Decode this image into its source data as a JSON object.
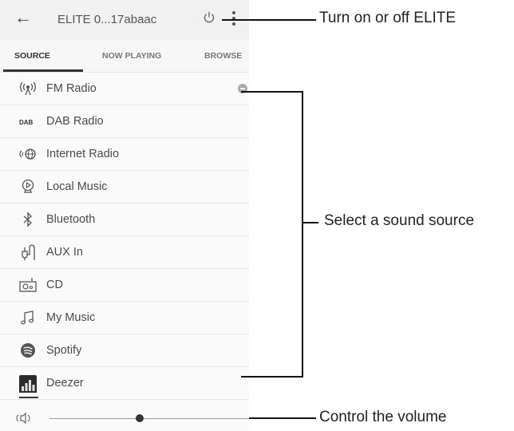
{
  "header": {
    "back_icon": "arrow-left-icon",
    "title": "ELITE 0...17abaac",
    "power_icon": "power-icon",
    "menu_icon": "more-vertical-icon"
  },
  "tabs": [
    {
      "label": "SOURCE",
      "active": true
    },
    {
      "label": "NOW PLAYING",
      "active": false
    },
    {
      "label": "BROWSE",
      "active": false
    }
  ],
  "sources": [
    {
      "label": "FM Radio",
      "icon": "fm-radio-icon",
      "selected": true
    },
    {
      "label": "DAB Radio",
      "icon": "dab-icon",
      "selected": false
    },
    {
      "label": "Internet Radio",
      "icon": "internet-radio-icon",
      "selected": false
    },
    {
      "label": "Local Music",
      "icon": "local-music-icon",
      "selected": false
    },
    {
      "label": "Bluetooth",
      "icon": "bluetooth-icon",
      "selected": false
    },
    {
      "label": "AUX In",
      "icon": "aux-icon",
      "selected": false
    },
    {
      "label": "CD",
      "icon": "cd-icon",
      "selected": false
    },
    {
      "label": "My Music",
      "icon": "music-note-icon",
      "selected": false
    },
    {
      "label": "Spotify",
      "icon": "spotify-icon",
      "selected": false
    },
    {
      "label": "Deezer",
      "icon": "deezer-icon",
      "selected": false
    }
  ],
  "volume": {
    "icon": "speaker-icon",
    "level_fraction": 0.45
  },
  "callouts": {
    "power": "Turn on or off ELITE",
    "source": "Select a sound source",
    "volume": "Control the volume"
  },
  "colors": {
    "appbar_bg": "#f1f1f1",
    "list_bg": "#fafafa",
    "text": "#4a4a4a",
    "callout_line": "#111111"
  }
}
